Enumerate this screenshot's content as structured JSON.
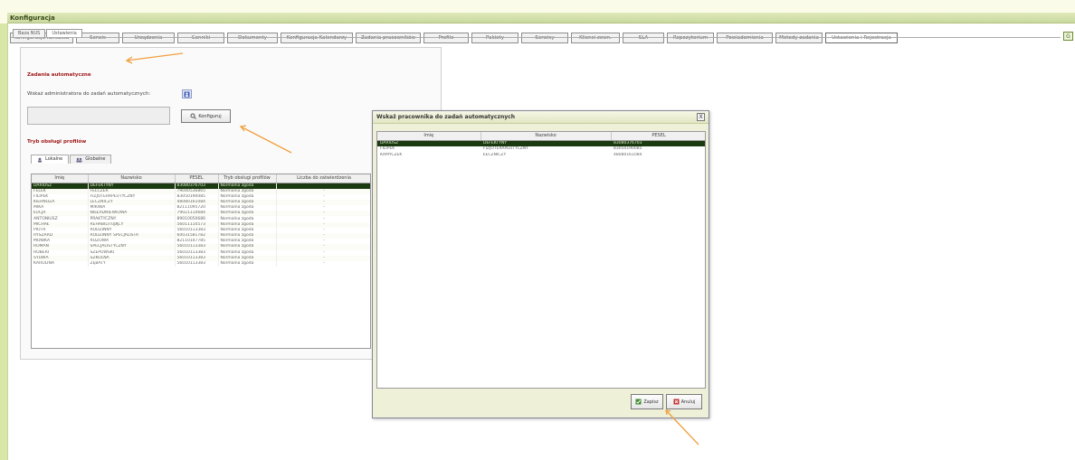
{
  "app": {
    "title": "Konfiguracja"
  },
  "main_tabs": [
    {
      "label": "Konfiguracja Kontaktu",
      "w": 70
    },
    {
      "label": "Serwis",
      "w": 48
    },
    {
      "label": "Urządzenia",
      "w": 58
    },
    {
      "label": "Cenniki",
      "w": 52
    },
    {
      "label": "Dokumenty",
      "w": 56
    },
    {
      "label": "Konfiguracja Kalendarzy",
      "w": 80
    },
    {
      "label": "Zadania pracowników",
      "w": 72
    },
    {
      "label": "Profile",
      "w": 50
    },
    {
      "label": "Pakiety",
      "w": 52
    },
    {
      "label": "Serwisy",
      "w": 52
    },
    {
      "label": "Klienci zewn.",
      "w": 54
    },
    {
      "label": "SLA",
      "w": 46
    },
    {
      "label": "Repozytorium",
      "w": 52
    },
    {
      "label": "Powiadomienia",
      "w": 62
    },
    {
      "label": "Metody zadania",
      "w": 52
    },
    {
      "label": "Ustawienia i Rejestracja",
      "w": 80,
      "active": true
    }
  ],
  "top_right_button": "G",
  "sub_tabs": {
    "tab1": "Baza NUS",
    "tab2": "Ustawienia"
  },
  "auto_tasks": {
    "title": "Zadania automatyczne",
    "label": "Wskaż administratora do zadań automatycznych:",
    "field_value": "",
    "button_label": "Konfiguruj"
  },
  "profiles": {
    "title": "Tryb obsługi profilów",
    "tab_local": "Lokalne",
    "tab_global": "Globalne",
    "columns": [
      "Imię",
      "Nazwisko",
      "PESEL",
      "Tryb obsługi profilów",
      "Liczba do zatwierdzenia"
    ],
    "rows": [
      {
        "imie": "DARIUSZ",
        "nazwisko": "DEFEKTYNY",
        "pesel": "83080376703",
        "tryb": "Normalna zgoda",
        "liczba": "",
        "selected": true
      },
      {
        "imie": "FELEK",
        "nazwisko": "FELCZER",
        "pesel": "79040536865",
        "tryb": "Normalna zgoda",
        "liczba": "-"
      },
      {
        "imie": "FILIPEK",
        "nazwisko": "FIZJOTERAPEUTYCZNY",
        "pesel": "83050190085",
        "tryb": "Normalna zgoda",
        "liczba": "-"
      },
      {
        "imie": "KIERNOZA",
        "nazwisko": "LECZNICZY",
        "pesel": "48080161084",
        "tryb": "Normalna zgoda",
        "liczba": "-"
      },
      {
        "imie": "MIKA",
        "nazwisko": "MIKIWA",
        "pesel": "82111095720",
        "tryb": "Normalna zgoda",
        "liczba": "-"
      },
      {
        "imie": "ŁUCJA",
        "nazwisko": "NIEŁADNIEWIOWA",
        "pesel": "79021110684",
        "tryb": "Normalna zgoda",
        "liczba": "-"
      },
      {
        "imie": "ANTONIUSZ",
        "nazwisko": "PRAKTYCZNY",
        "pesel": "89010050686",
        "tryb": "Normalna zgoda",
        "liczba": "-"
      },
      {
        "imie": "MICHAŁ",
        "nazwisko": "REHABILITUJĄCY",
        "pesel": "56011110573",
        "tryb": "Normalna zgoda",
        "liczba": "-"
      },
      {
        "imie": "PIOTR",
        "nazwisko": "RODZINNY",
        "pesel": "56010113383",
        "tryb": "Normalna zgoda",
        "liczba": "-"
      },
      {
        "imie": "RYSZARD",
        "nazwisko": "RODZINNY SPECJALISTA",
        "pesel": "60031581782",
        "tryb": "Normalna zgoda",
        "liczba": "-"
      },
      {
        "imie": "MONIKA",
        "nazwisko": "RÓŻOWA",
        "pesel": "82110147785",
        "tryb": "Normalna zgoda",
        "liczba": "-"
      },
      {
        "imie": "ROMAN",
        "nazwisko": "SPECJALISTYCZNY",
        "pesel": "56010113383",
        "tryb": "Normalna zgoda",
        "liczba": "-"
      },
      {
        "imie": "ROBERT",
        "nazwisko": "SZEPOWSKI",
        "pesel": "56010113383",
        "tryb": "Normalna zgoda",
        "liczba": "-"
      },
      {
        "imie": "SYLWIA",
        "nazwisko": "SZKOLNA",
        "pesel": "56010113383",
        "tryb": "Normalna zgoda",
        "liczba": "-"
      },
      {
        "imie": "KAROLINA",
        "nazwisko": "ZĘBATY",
        "pesel": "56010113383",
        "tryb": "Normalna zgoda",
        "liczba": "-"
      }
    ]
  },
  "dialog": {
    "title": "Wskaż pracownika do zadań automatycznych",
    "close": "X",
    "columns": [
      "Imię",
      "Nazwisko",
      "PESEL"
    ],
    "rows": [
      {
        "imie": "DARIUSZ",
        "nazwisko": "DEFEKTYNY",
        "pesel": "83080376703",
        "selected": true
      },
      {
        "imie": "FILIPEK",
        "nazwisko": "FIZJOTERAPEUTYCZNY",
        "pesel": "83050190085"
      },
      {
        "imie": "KAMYCZEK",
        "nazwisko": "ŁECZNICZY",
        "pesel": "48080161084"
      }
    ],
    "select_label": "Zapisz",
    "cancel_label": "Anuluj"
  },
  "colors": {
    "selected_row": "#1c3a12",
    "section_title": "#a01818",
    "annotation_arrow": "#f0a040"
  }
}
